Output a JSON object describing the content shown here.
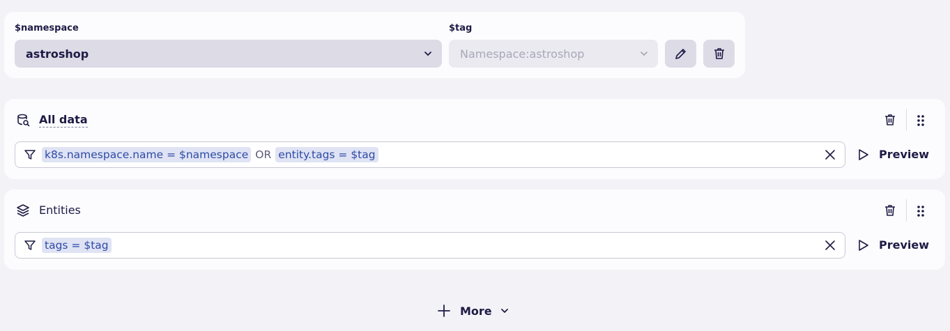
{
  "variables": {
    "namespace": {
      "label": "$namespace",
      "value": "astroshop"
    },
    "tag": {
      "label": "$tag",
      "placeholder": "Namespace:astroshop"
    }
  },
  "sources": [
    {
      "title": "All data",
      "icon": "data-bucket-icon",
      "filter": {
        "tokens": [
          "k8s.namespace.name = $namespace",
          "entity.tags = $tag"
        ],
        "operator": "OR"
      },
      "preview_label": "Preview"
    },
    {
      "title": "Entities",
      "icon": "layers-icon",
      "filter": {
        "tokens": [
          "tags = $tag"
        ]
      },
      "preview_label": "Preview"
    }
  ],
  "more_label": "More",
  "colors": {
    "background": "#f3f3f7",
    "card": "#fcfcfe",
    "token_bg": "#dfe3f3",
    "token_text": "#2e4aa8",
    "text": "#1e1b45"
  }
}
